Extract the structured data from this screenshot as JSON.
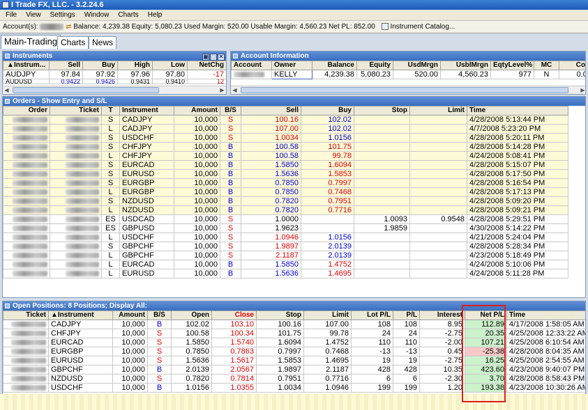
{
  "window": {
    "title": "I Trade FX, LLC. - 3.2.24.6"
  },
  "menu": [
    "File",
    "View",
    "Settings",
    "Window",
    "Charts",
    "Help"
  ],
  "toolbar": {
    "account_label": "Account(s):",
    "balance": "Balance: 4,239.38",
    "equity": "Equity: 5,080.23",
    "used_margin": "Used Margin: 520.00",
    "usable_margin": "Usable Margin: 4,560.23",
    "net_pl": "Net PL: 852.00",
    "catalog": "Instrument Catalog..."
  },
  "tabs": [
    "Main-Trading",
    "Charts",
    "News"
  ],
  "instruments": {
    "title": "Instruments",
    "headers": [
      "▲Instrum...",
      "Sell",
      "Buy",
      "High",
      "Low",
      "NetChg"
    ],
    "rows": [
      [
        "AUDJPY",
        "97.84",
        "97.92",
        "97.96",
        "97.80",
        "-17"
      ],
      [
        "AUDUSD",
        "0.9422",
        "0.9426",
        "0.9431",
        "0.9410",
        "12"
      ]
    ]
  },
  "account": {
    "title": "Account Information",
    "headers": [
      "Account",
      "Owner",
      "Balance",
      "Equity",
      "UsdMrgn",
      "UsblMrgn",
      "EqtyLevel%",
      "MC",
      "Com"
    ],
    "row": [
      "",
      "KELLY",
      "4,239.38",
      "5,080.23",
      "520.00",
      "4,560.23",
      "977",
      "N",
      "0.00"
    ]
  },
  "orders": {
    "title": "Orders - Show Entry and S/L",
    "headers": [
      "Order",
      "Ticket",
      "T",
      "Instrument",
      "Amount",
      "B/S",
      "Sell",
      "Buy",
      "Stop",
      "Limit",
      "Time"
    ],
    "rows": [
      {
        "t": "S",
        "inst": "CADJPY",
        "amt": "10,000",
        "bs": "S",
        "sell": "100.16",
        "buy": "102.02",
        "stop": "",
        "limit": "",
        "time": "4/28/2008 5:13:44 PM",
        "sc": "red",
        "bc": "blue",
        "hl": "yel"
      },
      {
        "t": "L",
        "inst": "CADJPY",
        "amt": "10,000",
        "bs": "S",
        "sell": "107.00",
        "buy": "102.02",
        "stop": "",
        "limit": "",
        "time": "4/7/2008 5:23:20 PM",
        "sc": "red",
        "bc": "blue",
        "hl": "yel"
      },
      {
        "t": "S",
        "inst": "USDCHF",
        "amt": "10,000",
        "bs": "S",
        "sell": "1.0034",
        "buy": "1.0156",
        "stop": "",
        "limit": "",
        "time": "4/28/2008 5:20:11 PM",
        "sc": "red",
        "bc": "blue",
        "hl": "yel"
      },
      {
        "t": "S",
        "inst": "CHFJPY",
        "amt": "10,000",
        "bs": "B",
        "sell": "100.58",
        "buy": "101.75",
        "stop": "",
        "limit": "",
        "time": "4/28/2008 5:14:28 PM",
        "sc": "blue",
        "bc": "red",
        "hl": "yel"
      },
      {
        "t": "L",
        "inst": "CHFJPY",
        "amt": "10,000",
        "bs": "B",
        "sell": "100.58",
        "buy": "99.78",
        "stop": "",
        "limit": "",
        "time": "4/24/2008 5:08:41 PM",
        "sc": "blue",
        "bc": "red",
        "hl": "yel"
      },
      {
        "t": "S",
        "inst": "EURCAD",
        "amt": "10,000",
        "bs": "B",
        "sell": "1.5850",
        "buy": "1.6094",
        "stop": "",
        "limit": "",
        "time": "4/28/2008 5:15:07 PM",
        "sc": "blue",
        "bc": "red",
        "hl": "yel"
      },
      {
        "t": "S",
        "inst": "EURUSD",
        "amt": "10,000",
        "bs": "B",
        "sell": "1.5636",
        "buy": "1.5853",
        "stop": "",
        "limit": "",
        "time": "4/28/2008 5:17:50 PM",
        "sc": "blue",
        "bc": "red",
        "hl": "yel"
      },
      {
        "t": "S",
        "inst": "EURGBP",
        "amt": "10,000",
        "bs": "B",
        "sell": "0.7850",
        "buy": "0.7997",
        "stop": "",
        "limit": "",
        "time": "4/28/2008 5:16:54 PM",
        "sc": "blue",
        "bc": "red",
        "hl": "yel"
      },
      {
        "t": "L",
        "inst": "EURGBP",
        "amt": "10,000",
        "bs": "B",
        "sell": "0.7850",
        "buy": "0.7468",
        "stop": "",
        "limit": "",
        "time": "4/28/2008 5:17:13 PM",
        "sc": "blue",
        "bc": "red",
        "hl": "yel"
      },
      {
        "t": "S",
        "inst": "NZDUSD",
        "amt": "10,000",
        "bs": "B",
        "sell": "0.7820",
        "buy": "0.7951",
        "stop": "",
        "limit": "",
        "time": "4/28/2008 5:09:20 PM",
        "sc": "blue",
        "bc": "red",
        "hl": "yel"
      },
      {
        "t": "L",
        "inst": "NZDUSD",
        "amt": "10,000",
        "bs": "B",
        "sell": "0.7820",
        "buy": "0.7716",
        "stop": "",
        "limit": "",
        "time": "4/28/2008 5:09:21 PM",
        "sc": "blue",
        "bc": "red",
        "hl": "yel"
      },
      {
        "t": "ES",
        "inst": "USDCAD",
        "amt": "10,000",
        "bs": "S",
        "sell": "1.0000",
        "buy": "",
        "stop": "1.0093",
        "limit": "0.9548",
        "time": "4/28/2008 5:29:51 PM",
        "sc": "",
        "bc": "",
        "hl": ""
      },
      {
        "t": "ES",
        "inst": "GBPUSD",
        "amt": "10,000",
        "bs": "S",
        "sell": "1.9623",
        "buy": "",
        "stop": "1.9859",
        "limit": "",
        "time": "4/30/2008 5:14:22 PM",
        "sc": "",
        "bc": "",
        "hl": ""
      },
      {
        "t": "L",
        "inst": "USDCHF",
        "amt": "10,000",
        "bs": "S",
        "sell": "1.0946",
        "buy": "1.0156",
        "stop": "",
        "limit": "",
        "time": "4/21/2008 5:24:04 PM",
        "sc": "red",
        "bc": "blue",
        "hl": ""
      },
      {
        "t": "S",
        "inst": "GBPCHF",
        "amt": "10,000",
        "bs": "S",
        "sell": "1.9897",
        "buy": "2.0139",
        "stop": "",
        "limit": "",
        "time": "4/28/2008 5:28:34 PM",
        "sc": "red",
        "bc": "blue",
        "hl": ""
      },
      {
        "t": "L",
        "inst": "GBPCHF",
        "amt": "10,000",
        "bs": "S",
        "sell": "2.1187",
        "buy": "2.0139",
        "stop": "",
        "limit": "",
        "time": "4/23/2008 5:18:49 PM",
        "sc": "red",
        "bc": "blue",
        "hl": ""
      },
      {
        "t": "L",
        "inst": "EURCAD",
        "amt": "10,000",
        "bs": "B",
        "sell": "1.5850",
        "buy": "1.4752",
        "stop": "",
        "limit": "",
        "time": "4/24/2008 5:10:06 PM",
        "sc": "blue",
        "bc": "red",
        "hl": ""
      },
      {
        "t": "L",
        "inst": "EURUSD",
        "amt": "10,000",
        "bs": "B",
        "sell": "1.5636",
        "buy": "1.4695",
        "stop": "",
        "limit": "",
        "time": "4/24/2008 5:11:28 PM",
        "sc": "blue",
        "bc": "red",
        "hl": ""
      }
    ]
  },
  "positions": {
    "title": "Open Positions: 8 Positions; Display All:",
    "headers": [
      "Ticket",
      "▲Instrument",
      "Amount",
      "B/S",
      "Open",
      "Close",
      "Stop",
      "Limit",
      "Lot P/L",
      "P/L",
      "Interest",
      "Net P/L",
      "Time"
    ],
    "rows": [
      {
        "inst": "CADJPY",
        "amt": "10,000",
        "bs": "B",
        "open": "102.02",
        "close": "103.10",
        "stop": "100.16",
        "limit": "107.00",
        "lot": "108",
        "pl": "108",
        "int": "8.95",
        "net": "112.89",
        "time": "4/17/2008 1:58:05 AM",
        "pos": true
      },
      {
        "inst": "CHFJPY",
        "amt": "10,000",
        "bs": "S",
        "open": "100.58",
        "close": "100.34",
        "stop": "101.75",
        "limit": "99.78",
        "lot": "24",
        "pl": "24",
        "int": "-2.75",
        "net": "20.35",
        "time": "4/25/2008 12:33:22 AM",
        "pos": true
      },
      {
        "inst": "EURCAD",
        "amt": "10,000",
        "bs": "S",
        "open": "1.5850",
        "close": "1.5740",
        "stop": "1.6094",
        "limit": "1.4752",
        "lot": "110",
        "pl": "110",
        "int": "-2.00",
        "net": "107.21",
        "time": "4/25/2008 6:10:54 AM",
        "pos": true
      },
      {
        "inst": "EURGBP",
        "amt": "10,000",
        "bs": "S",
        "open": "0.7850",
        "close": "0.7863",
        "stop": "0.7997",
        "limit": "0.7468",
        "lot": "-13",
        "pl": "-13",
        "int": "0.45",
        "net": "-25.38",
        "time": "4/28/2008 8:04:35 AM",
        "pos": false
      },
      {
        "inst": "EURUSD",
        "amt": "10,000",
        "bs": "S",
        "open": "1.5636",
        "close": "1.5617",
        "stop": "1.5853",
        "limit": "1.4695",
        "lot": "19",
        "pl": "19",
        "int": "-2.75",
        "net": "16.25",
        "time": "4/25/2008 2:54:55 AM",
        "pos": true
      },
      {
        "inst": "GBPCHF",
        "amt": "10,000",
        "bs": "B",
        "open": "2.0139",
        "close": "2.0567",
        "stop": "1.9897",
        "limit": "2.1187",
        "lot": "428",
        "pl": "428",
        "int": "10.35",
        "net": "423.60",
        "time": "4/23/2008 9:40:07 PM",
        "pos": true
      },
      {
        "inst": "NZDUSD",
        "amt": "10,000",
        "bs": "S",
        "open": "0.7820",
        "close": "0.7814",
        "stop": "0.7951",
        "limit": "0.7716",
        "lot": "6",
        "pl": "6",
        "int": "-2.30",
        "net": "3.70",
        "time": "4/28/2008 8:58:43 PM",
        "pos": true
      },
      {
        "inst": "USDCHF",
        "amt": "10,000",
        "bs": "B",
        "open": "1.0156",
        "close": "1.0355",
        "stop": "1.0034",
        "limit": "1.0946",
        "lot": "199",
        "pl": "199",
        "int": "1.20",
        "net": "193.38",
        "time": "4/23/2008 10:30:26 AM",
        "pos": true
      }
    ]
  },
  "colors": {
    "accent": "#3a6fc0",
    "sell_red": "#e00000",
    "buy_blue": "#0000d0",
    "highlight_yellow": "#fdfad8",
    "profit_green": "#ccf2cc",
    "loss_pink": "#f8c8c8",
    "annotation_red": "#d82020"
  }
}
